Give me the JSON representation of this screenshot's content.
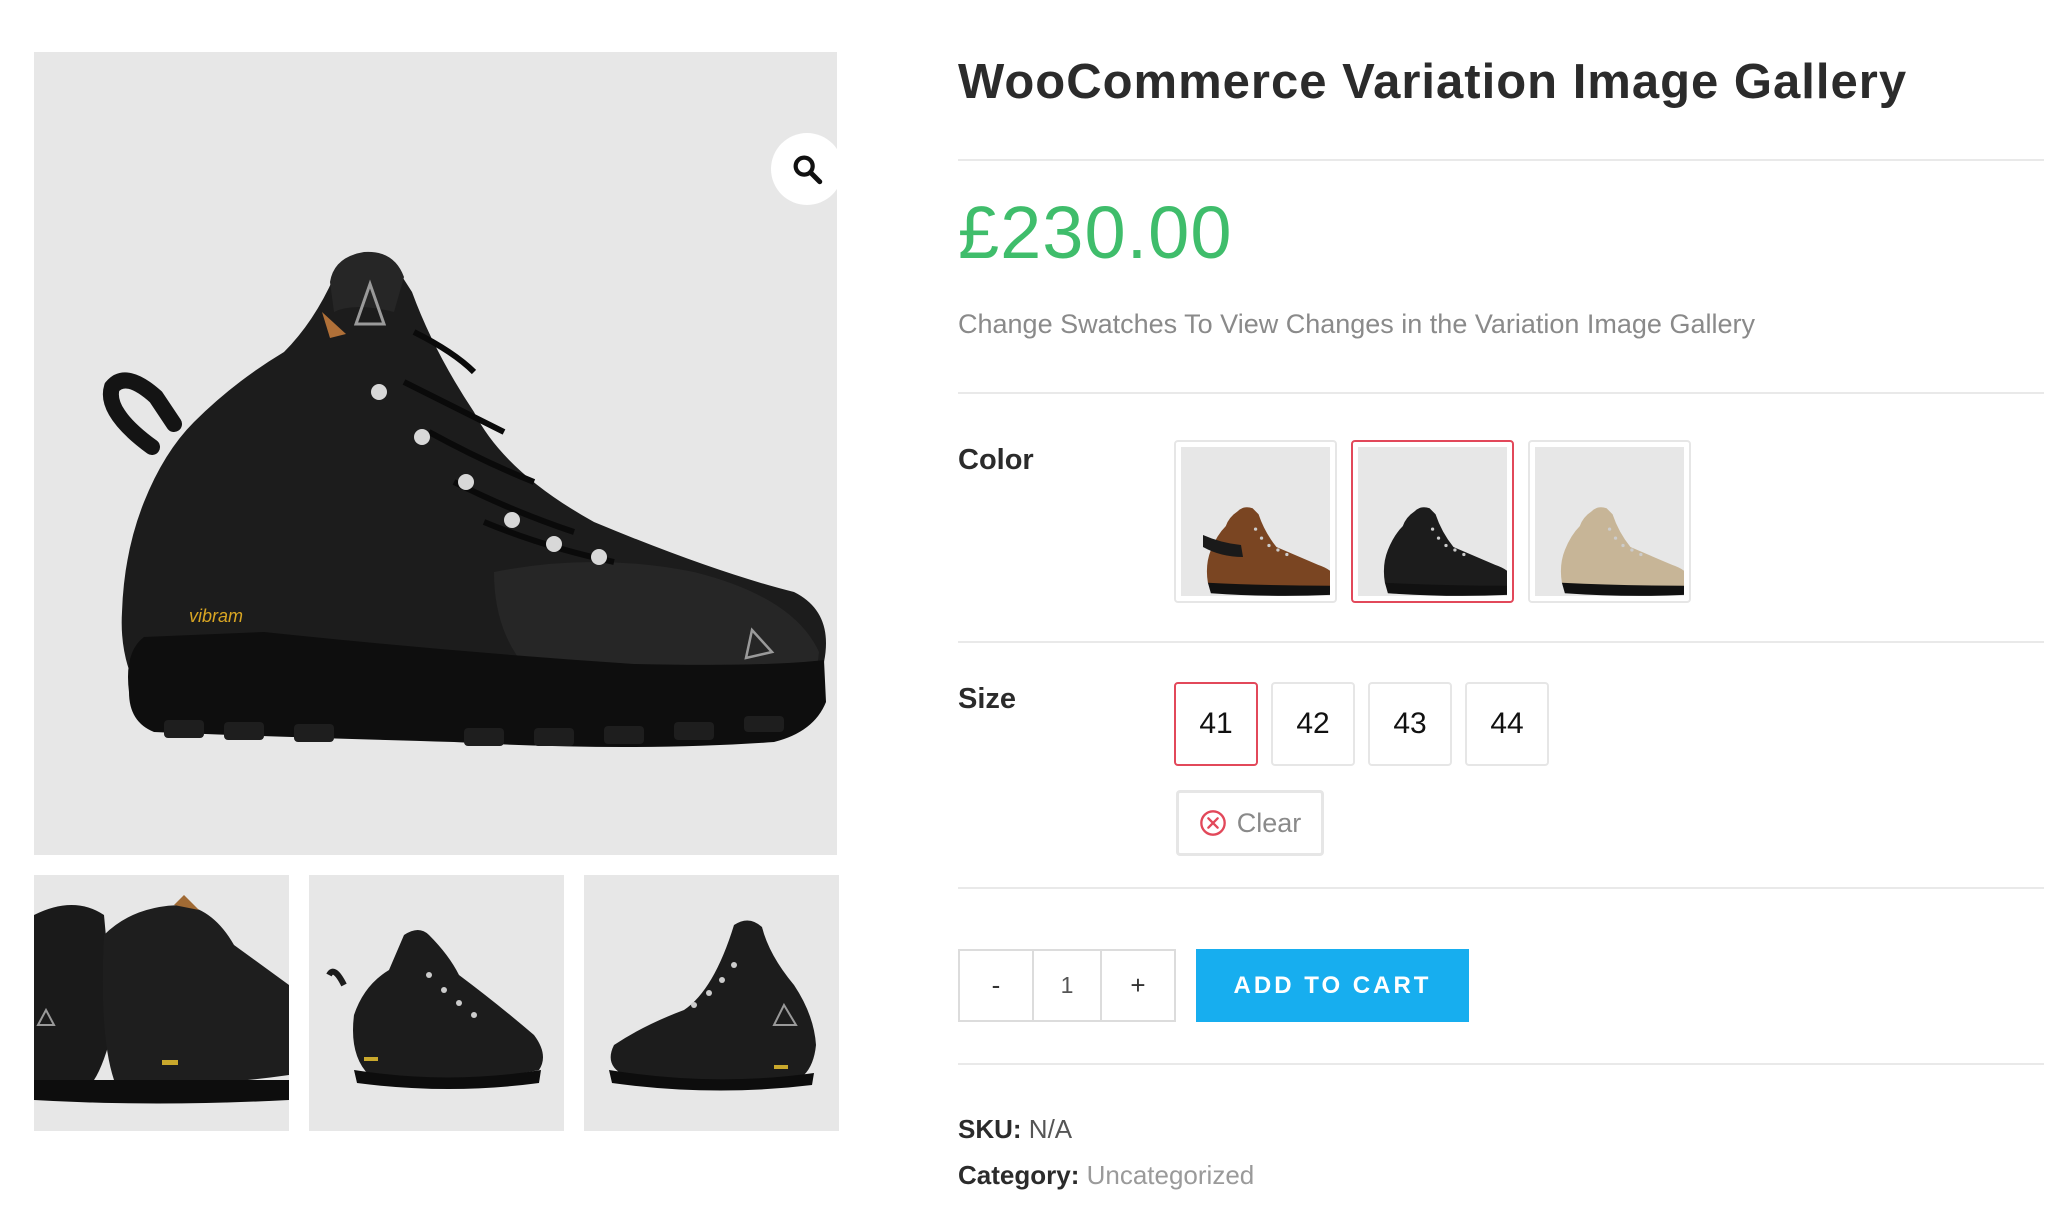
{
  "gallery": {
    "zoom_icon": "magnifier-icon",
    "main_image": "black-hiking-boot",
    "thumbnails": [
      "black-boots-rear-pair",
      "black-boot-front-angle",
      "black-boot-side-angle"
    ]
  },
  "product": {
    "title": "WooCommerce Variation Image Gallery",
    "price": "£230.00",
    "short_description": "Change Swatches To View Changes in the Variation Image Gallery"
  },
  "attributes": {
    "color": {
      "label": "Color",
      "options": [
        "brown-boot",
        "black-boot",
        "beige-boot"
      ],
      "selected": "black-boot"
    },
    "size": {
      "label": "Size",
      "options": [
        "41",
        "42",
        "43",
        "44"
      ],
      "selected": "41"
    },
    "clear_label": "Clear"
  },
  "cart": {
    "minus": "-",
    "quantity": "1",
    "plus": "+",
    "add_to_cart": "ADD TO CART"
  },
  "meta": {
    "sku_label": "SKU:",
    "sku_value": "N/A",
    "category_label": "Category:",
    "category_value": "Uncategorized"
  },
  "colors": {
    "price": "#3fbd6b",
    "button": "#17aeef",
    "selected_border": "#e2485a",
    "clear_icon": "#e2485a"
  }
}
